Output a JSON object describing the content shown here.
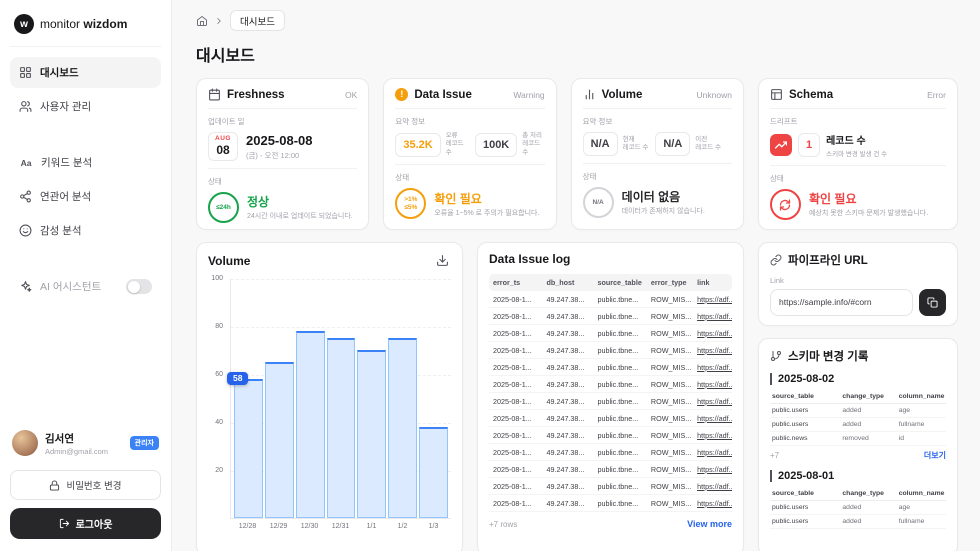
{
  "colors": {
    "red": "#ef4444",
    "orange": "#f59e0b",
    "green": "#16a34a",
    "blue": "#3b82f6",
    "dark": "#27272a"
  },
  "sidebar": {
    "logo_monitor": "monitor",
    "logo_wizdom": "wizdom",
    "items": {
      "dashboard": "대시보드",
      "users": "사용자 관리",
      "keyword": "키워드 분석",
      "related": "연관어 분석",
      "sentiment": "감성 분석",
      "ai": "AI 어시스턴트"
    },
    "user": {
      "name": "김서연",
      "email": "Admin@gmail.com",
      "role_badge": "관리자"
    },
    "password_button": "비밀번호 변경",
    "logout_button": "로그아웃"
  },
  "breadcrumb": {
    "current": "대시보드"
  },
  "page_title": "대시보드",
  "cards": {
    "freshness": {
      "title": "Freshness",
      "status": "OK",
      "section1_label": "업데이트 일",
      "date_month": "AUG",
      "date_day": "08",
      "date": "2025-08-08",
      "date_sub": "(금) - 오전 12:00",
      "section2_label": "상태",
      "badge": "≤24h",
      "state": "정상",
      "desc": "24시간 이내로 업데이트 되었습니다."
    },
    "data_issue": {
      "title": "Data Issue",
      "status": "Warning",
      "warn_mark": "!",
      "section1_label": "요약 정보",
      "metric1_value": "35.2K",
      "metric1_label1": "오류",
      "metric1_label2": "레코드 수",
      "metric2_value": "100K",
      "metric2_label1": "총 처리",
      "metric2_label2": "레코드 수",
      "section2_label": "상태",
      "badge_line1": ">1%",
      "badge_line2": "≤5%",
      "state": "확인 필요",
      "desc": "오류율 1~5% 로 주의가 필요합니다."
    },
    "volume": {
      "title": "Volume",
      "status": "Unknown",
      "section1_label": "요약 정보",
      "metric1_value": "N/A",
      "metric1_label1": "현재",
      "metric1_label2": "레코드 수",
      "metric2_value": "N/A",
      "metric2_label1": "이전",
      "metric2_label2": "레코드 수",
      "section2_label": "상태",
      "badge": "N/A",
      "state": "데이터 없음",
      "desc": "데이터가 존재하지 않습니다."
    },
    "schema": {
      "title": "Schema",
      "status": "Error",
      "section1_label": "드리프트",
      "metric_value": "1",
      "metric_name": "레코드 수",
      "metric_sub": "스키마 변경 발생 건 수",
      "section2_label": "상태",
      "state": "확인 필요",
      "desc": "예상치 못한 스키마 문제가 발생했습니다."
    }
  },
  "chart_card": {
    "title": "Volume"
  },
  "chart_data": {
    "type": "bar",
    "title": "Volume",
    "categories": [
      "12/28",
      "12/29",
      "12/30",
      "12/31",
      "1/1",
      "1/2",
      "1/3"
    ],
    "values": [
      58,
      65,
      78,
      75,
      70,
      75,
      38
    ],
    "tooltip": {
      "index": 0,
      "label": "58"
    },
    "ylim": [
      0,
      100
    ],
    "yticks": [
      20,
      40,
      60,
      80,
      100
    ],
    "xlabel": "",
    "ylabel": "",
    "grid": true,
    "legend": false
  },
  "issue_log": {
    "title": "Data Issue log",
    "headers": [
      "error_ts",
      "db_host",
      "source_table",
      "error_type",
      "link"
    ],
    "rows": [
      {
        "error_ts": "2025-08-1...",
        "db_host": "49.247.38...",
        "source_table": "public.tbne...",
        "error_type": "ROW_MIS...",
        "link": "https://adf..."
      },
      {
        "error_ts": "2025-08-1...",
        "db_host": "49.247.38...",
        "source_table": "public.tbne...",
        "error_type": "ROW_MIS...",
        "link": "https://adf..."
      },
      {
        "error_ts": "2025-08-1...",
        "db_host": "49.247.38...",
        "source_table": "public.tbne...",
        "error_type": "ROW_MIS...",
        "link": "https://adf..."
      },
      {
        "error_ts": "2025-08-1...",
        "db_host": "49.247.38...",
        "source_table": "public.tbne...",
        "error_type": "ROW_MIS...",
        "link": "https://adf..."
      },
      {
        "error_ts": "2025-08-1...",
        "db_host": "49.247.38...",
        "source_table": "public.tbne...",
        "error_type": "ROW_MIS...",
        "link": "https://adf..."
      },
      {
        "error_ts": "2025-08-1...",
        "db_host": "49.247.38...",
        "source_table": "public.tbne...",
        "error_type": "ROW_MIS...",
        "link": "https://adf..."
      },
      {
        "error_ts": "2025-08-1...",
        "db_host": "49.247.38...",
        "source_table": "public.tbne...",
        "error_type": "ROW_MIS...",
        "link": "https://adf..."
      },
      {
        "error_ts": "2025-08-1...",
        "db_host": "49.247.38...",
        "source_table": "public.tbne...",
        "error_type": "ROW_MIS...",
        "link": "https://adf..."
      },
      {
        "error_ts": "2025-08-1...",
        "db_host": "49.247.38...",
        "source_table": "public.tbne...",
        "error_type": "ROW_MIS...",
        "link": "https://adf..."
      },
      {
        "error_ts": "2025-08-1...",
        "db_host": "49.247.38...",
        "source_table": "public.tbne...",
        "error_type": "ROW_MIS...",
        "link": "https://adf..."
      },
      {
        "error_ts": "2025-08-1...",
        "db_host": "49.247.38...",
        "source_table": "public.tbne...",
        "error_type": "ROW_MIS...",
        "link": "https://adf..."
      },
      {
        "error_ts": "2025-08-1...",
        "db_host": "49.247.38...",
        "source_table": "public.tbne...",
        "error_type": "ROW_MIS...",
        "link": "https://adf..."
      },
      {
        "error_ts": "2025-08-1...",
        "db_host": "49.247.38...",
        "source_table": "public.tbne...",
        "error_type": "ROW_MIS...",
        "link": "https://adf..."
      }
    ],
    "footer_left": "+7 rows",
    "footer_right": "View more"
  },
  "pipeline": {
    "title": "파이프라인 URL",
    "link_label": "Link",
    "url": "https://sample.info/#corn"
  },
  "schema_history": {
    "title": "스키마 변경 기록",
    "headers": [
      "source_table",
      "change_type",
      "column_name"
    ],
    "sections": [
      {
        "date": "2025-08-02",
        "rows": [
          [
            "public.users",
            "added",
            "age"
          ],
          [
            "public.users",
            "added",
            "fullname"
          ],
          [
            "public.news",
            "removed",
            "id"
          ]
        ],
        "more_left": "+7",
        "more_right": "더보기"
      },
      {
        "date": "2025-08-01",
        "rows": [
          [
            "public.users",
            "added",
            "age"
          ],
          [
            "public.users",
            "added",
            "fullname"
          ]
        ]
      }
    ]
  }
}
